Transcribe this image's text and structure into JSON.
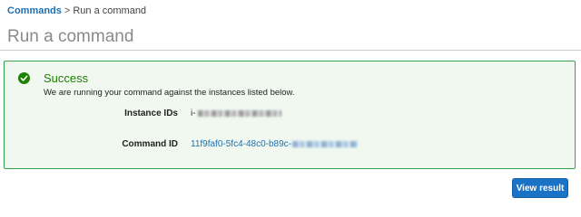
{
  "breadcrumb": {
    "parent_label": "Commands",
    "separator": ">",
    "current_label": "Run a command"
  },
  "page": {
    "title": "Run a command"
  },
  "alert": {
    "icon": "check-circle-icon",
    "title": "Success",
    "message": "We are running your command against the instances listed below.",
    "accent_color": "#1d8102",
    "background_color": "#f0f8f0"
  },
  "details": {
    "instance_ids_label": "Instance IDs",
    "instance_ids_value_prefix": "i-",
    "command_id_label": "Command ID",
    "command_id_value_prefix": "11f9faf0-5fc4-48c0-b89c-"
  },
  "actions": {
    "view_result_label": "View result",
    "button_color": "#1a73c7"
  }
}
